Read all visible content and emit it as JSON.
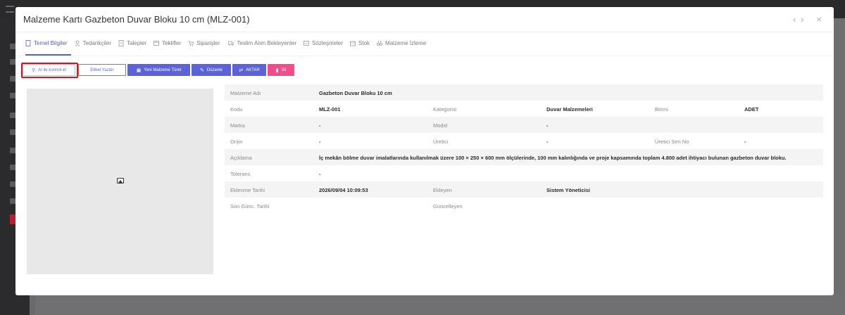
{
  "modal": {
    "title_prefix": "Malzeme Kartı",
    "title_item": "Gazbeton Duvar Bloku 10 cm (MLZ-001)",
    "prev_icon": "‹",
    "next_icon": "›",
    "close_icon": "×"
  },
  "tabs": [
    {
      "label": "Temel Bilgiler",
      "icon": "document-icon",
      "active": true
    },
    {
      "label": "Tedarikçiler",
      "icon": "supplier-icon"
    },
    {
      "label": "Talepler",
      "icon": "request-icon"
    },
    {
      "label": "Teklifler",
      "icon": "offer-icon"
    },
    {
      "label": "Siparişler",
      "icon": "cart-icon"
    },
    {
      "label": "Teslim Alım Bekleyenler",
      "icon": "truck-icon"
    },
    {
      "label": "Sözleşmeler",
      "icon": "contract-icon"
    },
    {
      "label": "Stok",
      "icon": "box-icon"
    },
    {
      "label": "Malzeme İzleme",
      "icon": "binoculars-icon"
    }
  ],
  "actions": {
    "ai_check": "AI ile kontrol et",
    "label_print": "Etiket Yazdır",
    "new_material": "Yeni Malzeme Türet",
    "edit": "Düzenle",
    "transfer": "AKTAR",
    "delete": "Sil"
  },
  "details": {
    "malzeme_adi_label": "Malzeme Adı",
    "malzeme_adi": "Gazbeton Duvar Bloku 10 cm",
    "kodu_label": "Kodu",
    "kodu": "MLZ-001",
    "kategori_label": "Kategorisi",
    "kategori": "Duvar Malzemeleri",
    "birim_label": "Birimi",
    "birim": "ADET",
    "marka_label": "Marka",
    "marka": "-",
    "model_label": "Model",
    "model": "-",
    "orijin_label": "Orijin",
    "orijin": "-",
    "uretici_label": "Üretici",
    "uretici": "-",
    "uretici_seri_label": "Üretici Seri No",
    "uretici_seri": "-",
    "aciklama_label": "Açıklama",
    "aciklama": "İç mekân bölme duvar imalatlarında kullanılmak üzere 100 × 250 × 600 mm ölçülerinde, 100 mm kalınlığında ve proje kapsamında toplam 4.800 adet ihtiyacı bulunan gazbeton duvar bloku.",
    "tolerans_label": "Tolerans",
    "tolerans": "-",
    "eklenme_label": "Eklenme Tarihi",
    "eklenme": "2026/09/04 10:09:53",
    "ekleyen_label": "Ekleyen",
    "ekleyen": "Sistem Yöneticisi",
    "guncelleme_label": "Son Günc. Tarihi",
    "guncelleyen_label": "Güncelleyen"
  },
  "colors": {
    "accent": "#5b63d6",
    "danger": "#f24d8a",
    "highlight": "#e1101a"
  }
}
